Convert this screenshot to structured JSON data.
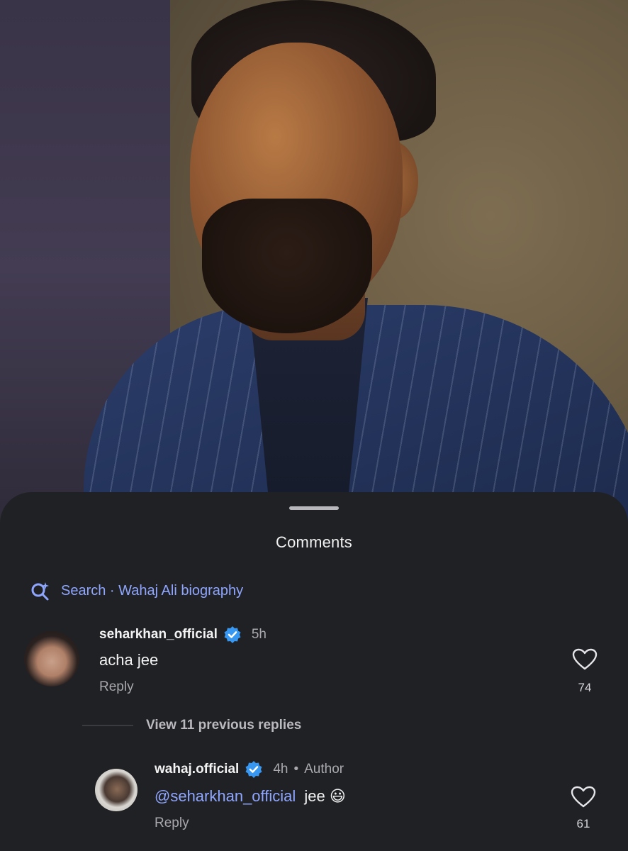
{
  "sheet": {
    "title": "Comments",
    "search_text": "Search · Wahaj Ali biography"
  },
  "comments": [
    {
      "username": "seharkhan_official",
      "time": "5h",
      "text": "acha jee",
      "reply_label": "Reply",
      "likes": "74"
    }
  ],
  "view_replies_label": "View 11 previous replies",
  "reply": {
    "username": "wahaj.official",
    "time": "4h",
    "separator": "•",
    "author_badge": "Author",
    "mention": "@seharkhan_official",
    "text": "jee",
    "emoji": "😃",
    "reply_label": "Reply",
    "likes": "61"
  },
  "icons": {
    "search": "search-sparkle-icon",
    "verified": "verified-badge-icon",
    "like": "heart-outline-icon"
  },
  "colors": {
    "sheet_bg": "#202125",
    "accent_link": "#8fa6ff",
    "verified": "#3897f0"
  }
}
